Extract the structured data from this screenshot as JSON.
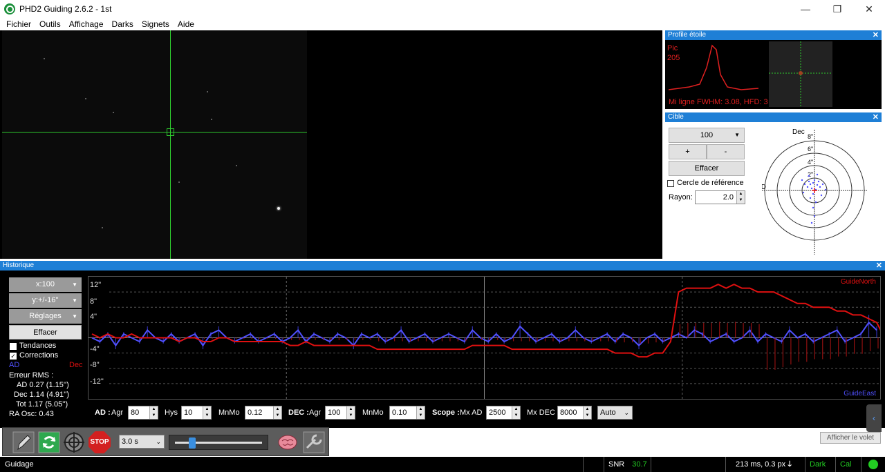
{
  "window": {
    "title": "PHD2 Guiding 2.6.2 - 1st",
    "minimize": "—",
    "restore": "❐",
    "close": "✕"
  },
  "menu": [
    "Fichier",
    "Outils",
    "Affichage",
    "Darks",
    "Signets",
    "Aide"
  ],
  "profile_panel": {
    "title": "Profile étoile",
    "close": "✕",
    "peak_label": "Pic",
    "peak_value": "205",
    "footer": "Mi ligne FWHM: 3.08, HFD: 3"
  },
  "target_panel": {
    "title": "Cible",
    "close": "✕",
    "scale": "100",
    "plus": "+",
    "minus": "-",
    "clear": "Effacer",
    "ref_circle": "Cercle de référence",
    "radius_label": "Rayon:",
    "radius_value": "2.0",
    "dec_label": "Dec",
    "ra_label": "AD",
    "rings": [
      "8\"",
      "6\"",
      "4\"",
      "2\""
    ]
  },
  "history": {
    "title": "Historique",
    "close": "✕",
    "x_scale": "x:100",
    "y_scale": "y:+/-16''",
    "settings": "Réglages",
    "clear": "Effacer",
    "trends": "Tendances",
    "corrections": "Corrections",
    "ra_label": "AD",
    "dec_label": "Dec",
    "rms_title": "Erreur RMS :",
    "rms_ra": "AD  0.27 (1.15'')",
    "rms_dec": "Dec  1.14 (4.91'')",
    "rms_tot": "Tot  1.17 (5.05'')",
    "ra_osc": "RA Osc: 0.43",
    "y_labels": [
      "12\"",
      "8\"",
      "4\"",
      "-4\"",
      "-8\"",
      "-12\""
    ],
    "guide_north": "GuideNorth",
    "guide_east": "GuideEast"
  },
  "controls": {
    "ad_label": "AD :",
    "agr_label": "Agr",
    "ad_agr": "80",
    "hys_label": "Hys",
    "hys": "10",
    "mnmo_label": "MnMo",
    "ad_mnmo": "0.12",
    "dec_label": "DEC :",
    "dec_agr": "100",
    "dec_mnmo": "0.10",
    "scope_label": "Scope :",
    "mx_ad_label": "Mx AD",
    "mx_ad": "2500",
    "mx_dec_label": "Mx DEC",
    "mx_dec": "8000",
    "mode": "Auto"
  },
  "toolbar": {
    "exposure": "3.0 s",
    "exposure_fraction": 0.2,
    "stop": "STOP"
  },
  "show_pane": "Afficher le volet",
  "status": {
    "left": "Guidage",
    "snr_label": "SNR",
    "snr_value": "30.7",
    "timing": "213 ms, 0.3 px",
    "dark": "Dark",
    "cal": "Cal"
  },
  "colors": {
    "ra": "#5050ff",
    "dec": "#e01010",
    "crosshair": "#2ecc2e",
    "panel_header": "#1e7fd6",
    "status_ok": "#22cc22"
  },
  "chart_data": {
    "type": "line",
    "y_unit": "arc-seconds",
    "ylim": [
      -16,
      16
    ],
    "x_points": 100,
    "series": [
      {
        "name": "AD",
        "color": "#5050ff",
        "values": [
          0,
          -1,
          1,
          -2,
          1,
          0,
          -1,
          2,
          0,
          -1,
          1,
          -1,
          0,
          1,
          -2,
          1,
          2,
          0,
          -1,
          0,
          1,
          -1,
          0,
          1,
          -1,
          0,
          2,
          -1,
          1,
          0,
          -1,
          1,
          0,
          -2,
          1,
          0,
          1,
          -1,
          0,
          2,
          -1,
          0,
          1,
          -1,
          0,
          1,
          0,
          -1,
          2,
          0,
          -1,
          1,
          -1,
          0,
          3,
          1,
          -1,
          0,
          1,
          -1,
          0,
          2,
          0,
          -1,
          0,
          1,
          -1,
          1,
          0,
          -2,
          0,
          1,
          -1,
          0,
          1,
          0,
          2,
          1,
          -1,
          0,
          1,
          -1,
          0,
          2,
          -1,
          1,
          0,
          -1,
          2,
          0,
          1,
          -1,
          0,
          1,
          2,
          -1,
          0,
          1,
          4,
          2
        ]
      },
      {
        "name": "Dec",
        "color": "#e01010",
        "values": [
          1,
          0,
          1,
          0,
          0,
          1,
          0,
          0,
          0,
          0,
          0,
          -1,
          0,
          0,
          -1,
          -1,
          0,
          0,
          -1,
          -1,
          -1,
          -1,
          -1,
          -1,
          -1,
          -2,
          -2,
          -1,
          -2,
          -2,
          -2,
          -2,
          -2,
          -2,
          -2,
          -2,
          -3,
          -3,
          -3,
          -3,
          -3,
          -3,
          -3,
          -3,
          -3,
          -3,
          -3,
          -3,
          -2,
          -2,
          -2,
          -2,
          -2,
          -3,
          -3,
          -3,
          -3,
          -3,
          -3,
          -3,
          -3,
          -3,
          -3,
          -3,
          -3,
          -3,
          -4,
          -4,
          -4,
          -5,
          -5,
          -4,
          -4,
          -1,
          12,
          13,
          13,
          13,
          13,
          14,
          13,
          14,
          13,
          13,
          12,
          12,
          12,
          11,
          10,
          9,
          9,
          8,
          8,
          8,
          7,
          7,
          6,
          6,
          5,
          4,
          0
        ]
      }
    ]
  }
}
